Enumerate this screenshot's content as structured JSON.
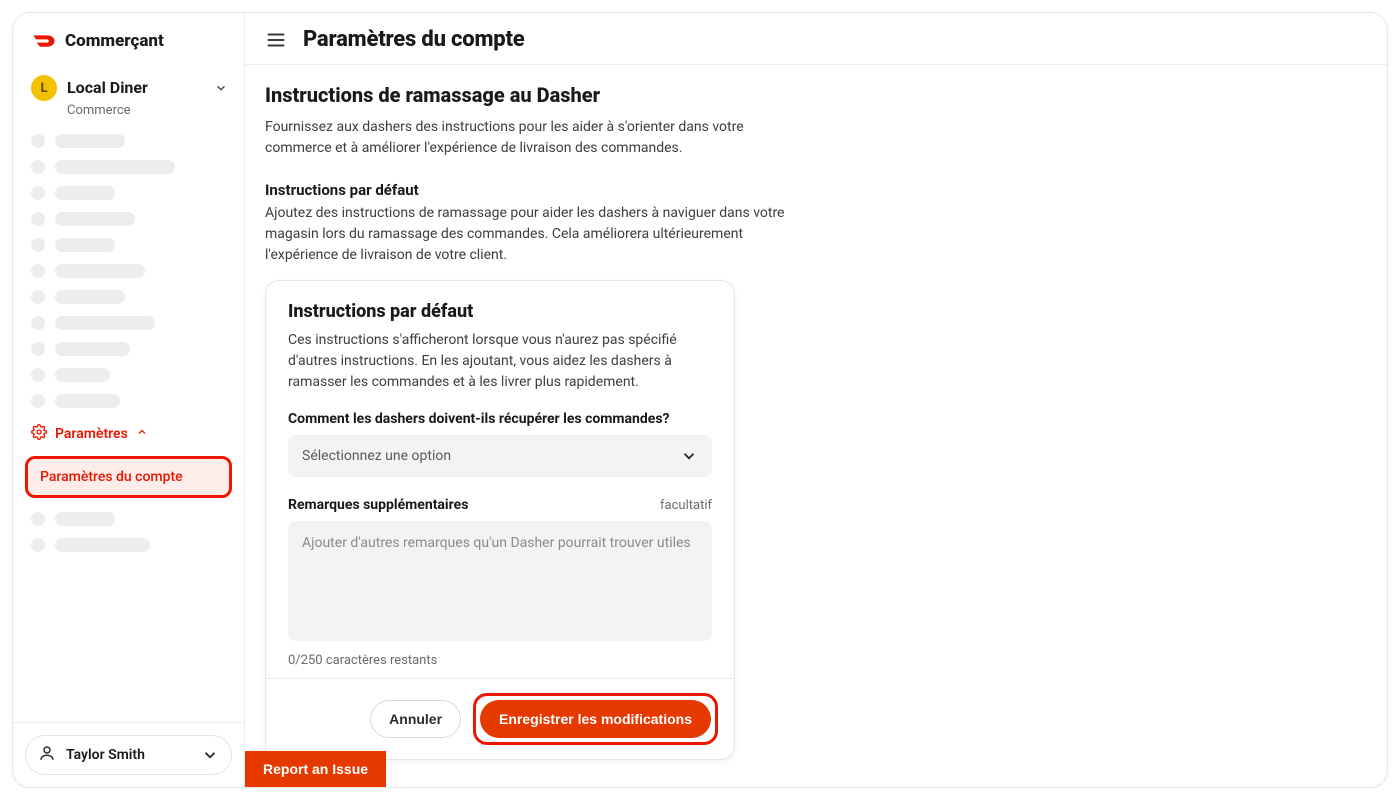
{
  "brand": {
    "name": "Commerçant"
  },
  "store": {
    "initial": "L",
    "name": "Local Diner",
    "subtitle": "Commerce"
  },
  "sidebar": {
    "settings_label": "Paramètres",
    "settings_sub_label": "Paramètres du compte"
  },
  "user": {
    "name": "Taylor Smith"
  },
  "header": {
    "title": "Paramètres du compte"
  },
  "section": {
    "title": "Instructions de ramassage au Dasher",
    "lead": "Fournissez aux dashers des instructions pour les aider à s'orienter dans votre commerce et à améliorer l'expérience de livraison des commandes.",
    "default_title": "Instructions par défaut",
    "default_lead": "Ajoutez des instructions de ramassage pour aider les dashers à naviguer dans votre magasin lors du ramassage des commandes. Cela améliorera ultérieurement l'expérience de livraison de votre client."
  },
  "card": {
    "title": "Instructions par défaut",
    "lead": "Ces instructions s'afficheront lorsque vous n'aurez pas spécifié d'autres instructions. En les ajoutant, vous aidez les dashers à ramasser les commandes et à les livrer plus rapidement.",
    "question_label": "Comment les dashers doivent-ils récupérer les commandes?",
    "select_placeholder": "Sélectionnez une option",
    "notes_label": "Remarques supplémentaires",
    "notes_optional": "facultatif",
    "notes_placeholder": "Ajouter d'autres remarques qu'un Dasher pourrait trouver utiles",
    "counter_text": "0/250 caractères restants",
    "cancel_label": "Annuler",
    "save_label": "Enregistrer les modifications"
  },
  "footer": {
    "report_label": "Report an Issue"
  },
  "colors": {
    "accent": "#EB1700",
    "primary_btn": "#E53900"
  }
}
